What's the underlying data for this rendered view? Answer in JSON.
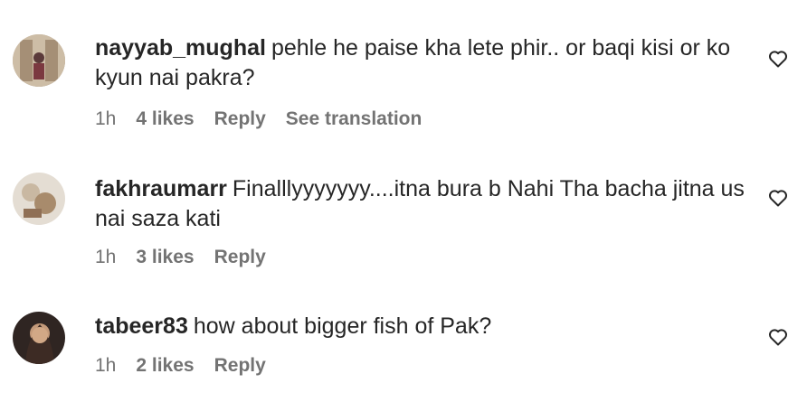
{
  "comments": [
    {
      "username": "nayyab_mughal",
      "text": "pehle he paise kha lete phir.. or baqi kisi or ko kyun nai pakra?",
      "time": "1h",
      "likes": "4 likes",
      "reply": "Reply",
      "translation": "See translation",
      "avatar_colors": [
        "#b9a48c",
        "#7a6656"
      ]
    },
    {
      "username": "fakhraumarr",
      "text": "Finalllyyyyyyy....itna bura b Nahi Tha bacha jitna us nai saza kati",
      "time": "1h",
      "likes": "3 likes",
      "reply": "Reply",
      "avatar_colors": [
        "#d9d4c9",
        "#9a7f66"
      ]
    },
    {
      "username": "tabeer83",
      "text": "how about bigger fish of Pak?",
      "time": "1h",
      "likes": "2 likes",
      "reply": "Reply",
      "avatar_colors": [
        "#3b2e2a",
        "#c49a7a"
      ]
    }
  ],
  "icons": {
    "like": "heart-outline-icon"
  }
}
